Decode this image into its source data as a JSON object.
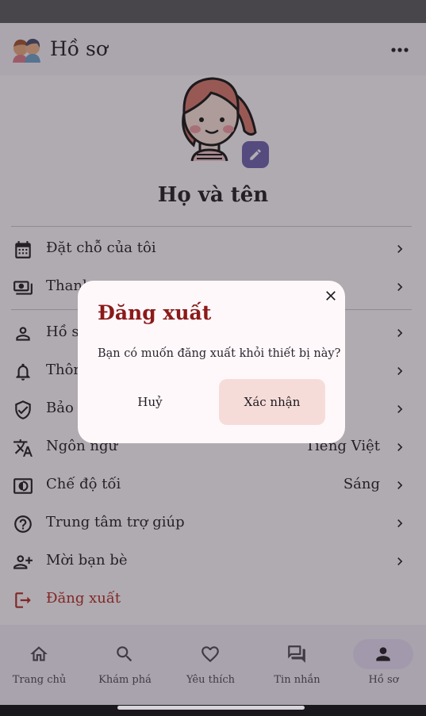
{
  "app_bar": {
    "title": "Hồ sơ",
    "logo_icon": "couple-avatars-logo",
    "more_icon": "more-horizontal-icon"
  },
  "profile": {
    "name": "Họ và tên",
    "avatar_icon": "girl-avatar-illustration",
    "edit_icon": "pencil-icon"
  },
  "menu": {
    "items": [
      {
        "label": "Đặt chỗ của tôi",
        "icon": "calendar-icon"
      },
      {
        "label": "Thanh",
        "icon": "payment-icon"
      },
      {
        "label": "Hồ sơ",
        "icon": "person-icon"
      },
      {
        "label": "Thôn",
        "icon": "bell-icon"
      },
      {
        "label": "Bảo m",
        "icon": "shield-icon"
      },
      {
        "label": "Ngôn ngữ",
        "value": "Tiếng Việt",
        "icon": "translate-icon"
      },
      {
        "label": "Chế độ tối",
        "value": "Sáng",
        "icon": "dark-mode-icon"
      },
      {
        "label": "Trung tâm trợ giúp",
        "icon": "help-icon"
      },
      {
        "label": "Mời bạn bè",
        "icon": "add-friend-icon"
      },
      {
        "label": "Đăng xuất",
        "icon": "logout-icon"
      }
    ]
  },
  "bottom_nav": {
    "items": [
      {
        "label": "Trang chủ",
        "icon": "home-icon"
      },
      {
        "label": "Khám phá",
        "icon": "search-icon"
      },
      {
        "label": "Yêu thích",
        "icon": "heart-icon"
      },
      {
        "label": "Tin nhắn",
        "icon": "chat-icon"
      },
      {
        "label": "Hồ sơ",
        "icon": "person-icon",
        "active": true
      }
    ]
  },
  "dialog": {
    "title": "Đăng xuất",
    "message": "Bạn có muốn đăng xuất khỏi thiết bị này?",
    "cancel_label": "Huỷ",
    "confirm_label": "Xác nhận",
    "close_icon": "close-icon"
  },
  "colors": {
    "accent": "#6f5fae",
    "danger": "#b3261e",
    "dialog_title": "#8b1a1a",
    "confirm_bg": "#f6dcd8"
  }
}
